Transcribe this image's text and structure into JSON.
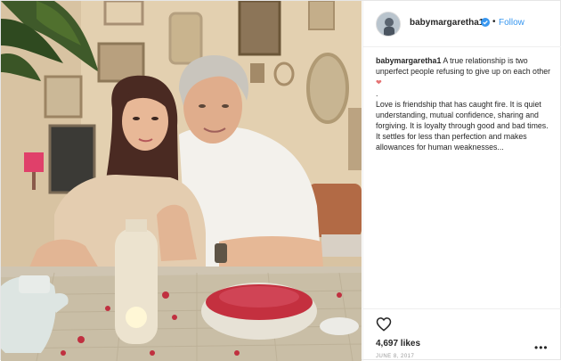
{
  "post": {
    "username": "babymargaretha1",
    "follow_label": "Follow",
    "separator": "•",
    "caption": {
      "username": "babymargaretha1",
      "line1": "A true relationship is two unperfect people refusing to give up on each other",
      "heart": "❤",
      "dot": ".",
      "line2": "Love is friendship that has caught fire. It is quiet understanding, mutual confidence, sharing and forgiving. It is loyalty through good and bad times. It settles for less than perfection and makes allowances for human weaknesses..."
    },
    "likes": "4,697 likes",
    "date": "JUNE 8, 2017",
    "more": "•••"
  },
  "icons": {
    "verified": "verified-badge-icon",
    "like": "heart-outline-icon",
    "more": "more-options-icon"
  },
  "colors": {
    "follow": "#3897f0",
    "verified": "#3897f0",
    "text": "#262626",
    "muted": "#999999"
  }
}
